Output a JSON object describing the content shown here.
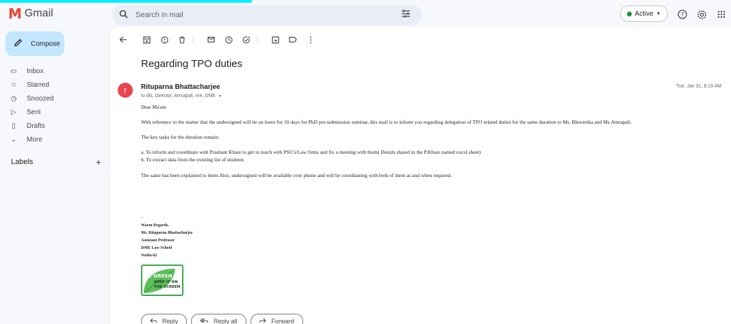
{
  "app": {
    "name": "Gmail",
    "logo_letter": "M"
  },
  "colors": {
    "accent": "#c2e7ff",
    "avatar": "#e8454f",
    "active": "#1e8e3e",
    "brand_red": "#ea4335",
    "badge_green": "#3aa74a"
  },
  "header": {
    "search_placeholder": "Search in mail",
    "status_label": "Active",
    "icons": [
      "search-icon",
      "filter-icon",
      "help-icon",
      "settings-icon",
      "apps-icon"
    ]
  },
  "sidebar": {
    "compose_label": "Compose",
    "items": [
      {
        "label": "Inbox",
        "icon": "inbox-icon",
        "glyph": "▭"
      },
      {
        "label": "Starred",
        "icon": "star-icon",
        "glyph": "☆"
      },
      {
        "label": "Snoozed",
        "icon": "clock-icon",
        "glyph": "◷"
      },
      {
        "label": "Sent",
        "icon": "send-icon",
        "glyph": "▷"
      },
      {
        "label": "Drafts",
        "icon": "draft-icon",
        "glyph": "▯"
      },
      {
        "label": "More",
        "icon": "chevron-down-icon",
        "glyph": "⌄"
      }
    ],
    "labels_title": "Labels",
    "labels_add": "+"
  },
  "toolbar": {
    "icons": [
      "back-icon",
      "archive-icon",
      "report-icon",
      "delete-icon",
      "mark-unread-icon",
      "snooze-icon",
      "add-task-icon",
      "move-icon",
      "label-icon",
      "more-icon"
    ]
  },
  "email": {
    "subject": "Regarding TPO duties",
    "avatar_letter": "r",
    "sender": "Rituparna Bhattacharjee",
    "recipients": "to dls, Director, Amrapali, me, DME",
    "date": "Tue, Jan 31, 8:19 AM",
    "body": {
      "greeting": "Dear Ma'am",
      "p1": "With reference to the matter that the undersigned will be on leave for 10 days for  PhD pre-submission seminar, this mail is to inform you regarding delegation of TPO related duties for the same duration to Ms. Bhoomika and Ms.Amrapali.",
      "p2": "The key tasks for the duration remain:",
      "task_a": "a. To inform and coordinate with Prashant Khare to get in touch with PSU's/Law firms and fix a meeting with them( Details shared in the P.Khare named excel sheet)",
      "task_b": "b. To extract data from the existing list of students",
      "p3": "The same has been explained to them.Also, undersigned will be available over phone and will be coordinating with both of them as and when required."
    },
    "signature": {
      "dashes": "--",
      "line1": "Warm Regards,",
      "line2": "Ms. Rituparna Bhattacharjee",
      "line3": "Assistant Professor",
      "line4": "DME Law School",
      "line5": "Noida-62"
    },
    "badge": {
      "line1": "BE GREEN",
      "line2": "KEEP IT ON",
      "line3": "THE SCREEN"
    }
  },
  "actions": {
    "reply": "Reply",
    "reply_all": "Reply all",
    "forward": "Forward"
  }
}
